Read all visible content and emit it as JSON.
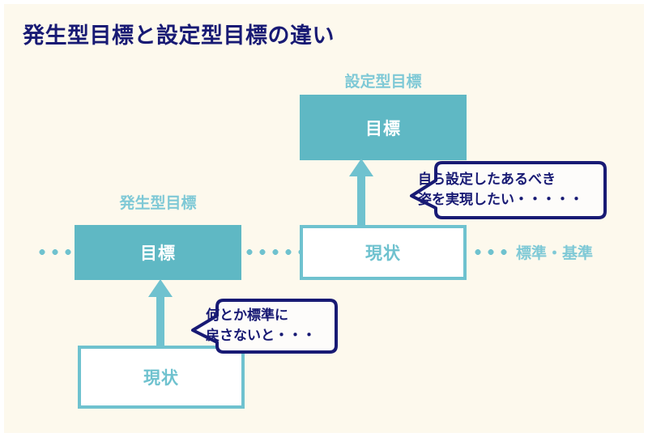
{
  "page": {
    "title": "発生型目標と設定型目標の違い",
    "background_color": "#fdf9ed",
    "title_color": "#181a74",
    "teal_color": "#5fb8c4",
    "teal_light_color": "#7fc9d6",
    "navy_color": "#181a74"
  },
  "diagram": {
    "type": "concept-comparison",
    "groups": [
      {
        "id": "settei",
        "caption": "設定型目標",
        "goal_box": {
          "label": "目標",
          "style": "filled-teal"
        },
        "current_box": {
          "label": "現状",
          "style": "outlined-white"
        },
        "arrow": "up",
        "bubble": {
          "line1": "自ら設定したあるべき",
          "line2": "姿を実現したい・・・・・"
        }
      },
      {
        "id": "hassei",
        "caption": "発生型目標",
        "goal_box": {
          "label": "目標",
          "style": "filled-teal"
        },
        "current_box": {
          "label": "現状",
          "style": "outlined-white"
        },
        "arrow": "up",
        "bubble": {
          "line1": "何とか標準に",
          "line2": "戻さないと・・・"
        }
      }
    ],
    "baseline": {
      "label": "標準・基準",
      "style": "dotted-teal-line"
    }
  }
}
